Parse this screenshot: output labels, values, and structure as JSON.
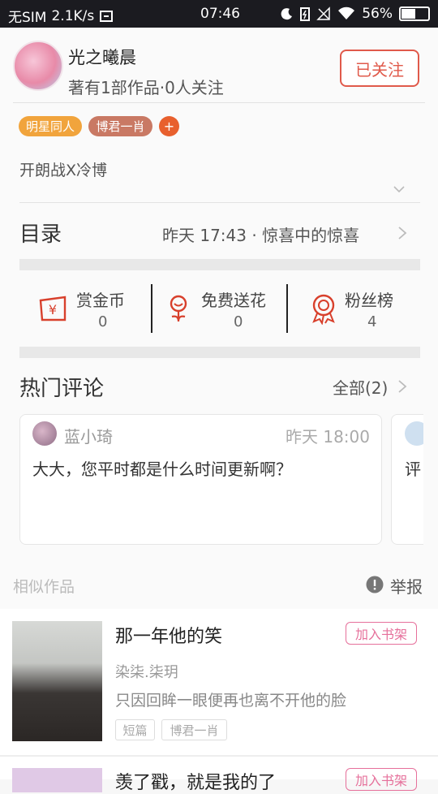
{
  "status_bar": {
    "carrier": "无SIM",
    "speed": "2.1K/s",
    "time": "07:46",
    "battery": "56%",
    "battery_level": 0.56
  },
  "author": {
    "name": "光之曦晨",
    "meta": "著有1部作品·0人关注",
    "follow_label": "已关注"
  },
  "tags": [
    "明星同人",
    "博君一肖"
  ],
  "add_tag_label": "+",
  "summary": "开朗战X冷博",
  "toc": {
    "label": "目录",
    "latest": "昨天 17:43 · 惊喜中的惊喜"
  },
  "stats": [
    {
      "label": "赏金币",
      "count": "0",
      "icon": "reward-coin-icon"
    },
    {
      "label": "免费送花",
      "count": "0",
      "icon": "flower-icon"
    },
    {
      "label": "粉丝榜",
      "count": "4",
      "icon": "medal-icon"
    }
  ],
  "hot_comments": {
    "title": "热门评论",
    "all_label": "全部(2)",
    "items": [
      {
        "user": "蓝小琦",
        "time": "昨天 18:00",
        "text": "大大，您平时都是什么时间更新啊？"
      },
      {
        "text": "评"
      }
    ]
  },
  "similar": {
    "label": "相似作品",
    "report_label": "举报",
    "books": [
      {
        "title": "那一年他的笑",
        "shelf_label": "加入书架",
        "author": "染柒.柒玥",
        "desc": "只因回眸一眼便再也离不开他的脸",
        "tags": [
          "短篇",
          "博君一肖"
        ]
      },
      {
        "title": "羡了戳，就是我的了",
        "shelf_label": "加入书架"
      }
    ]
  },
  "colors": {
    "accent": "#e05a4b",
    "shelf_pink": "#e6709b",
    "tag_orange": "#f1a43c",
    "tag_brown": "#c97964"
  }
}
